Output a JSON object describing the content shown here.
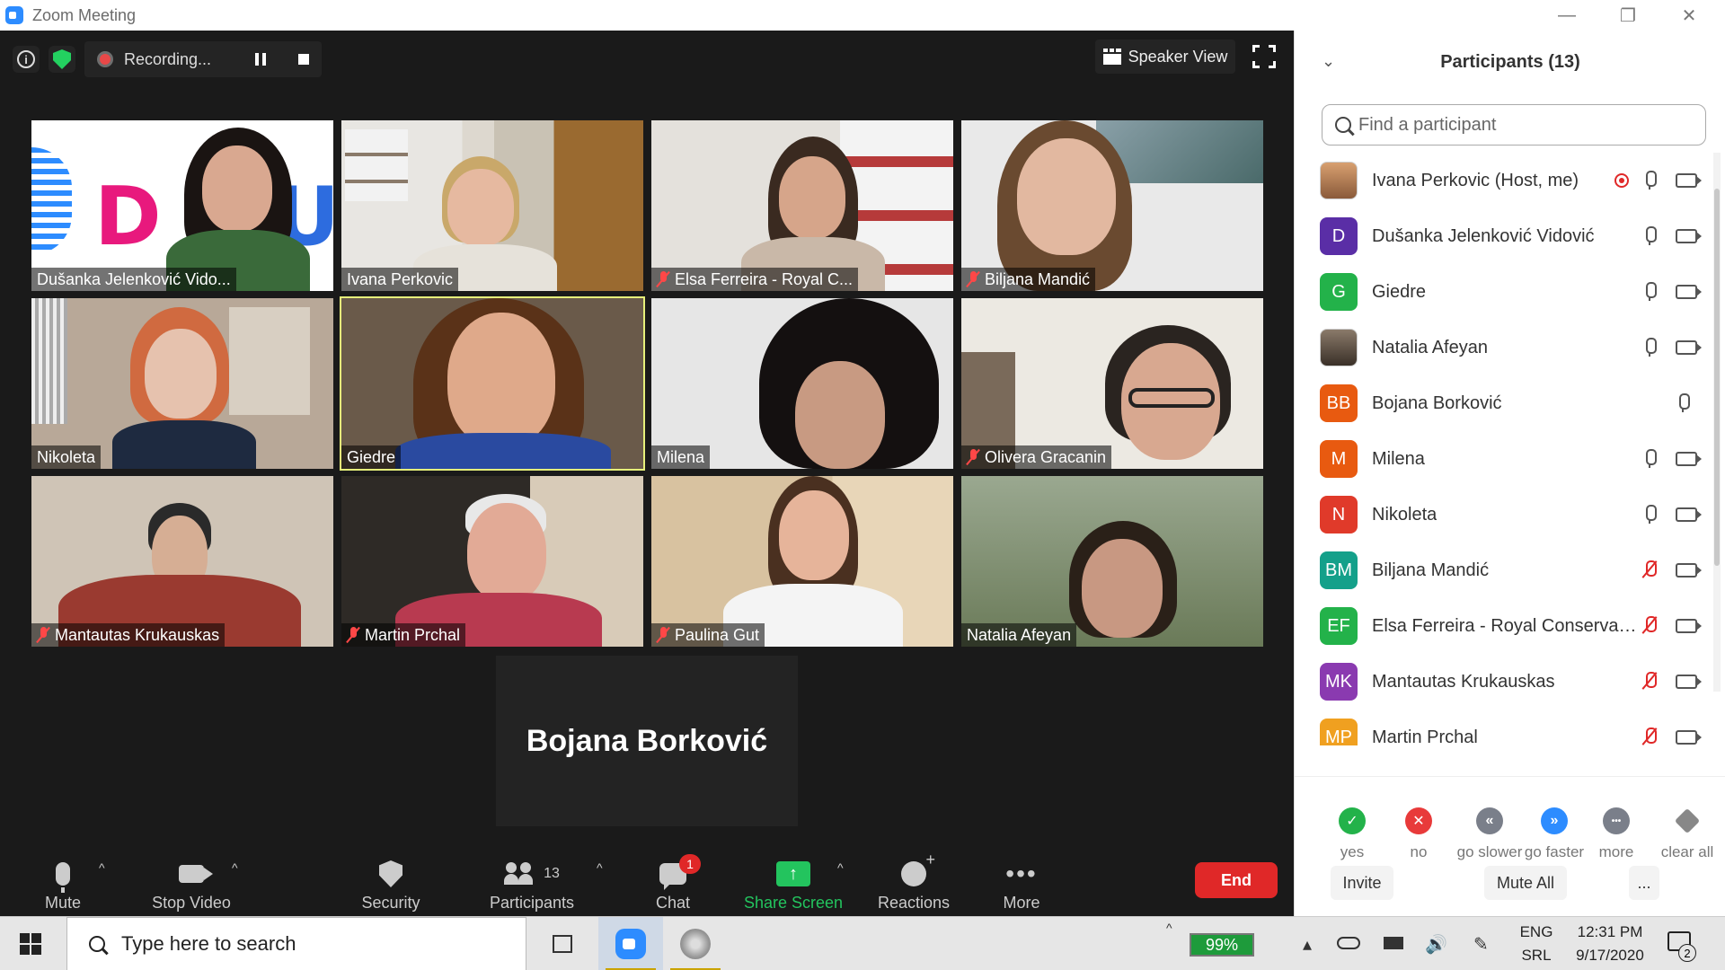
{
  "window": {
    "title": "Zoom Meeting",
    "controls": {
      "minimize": "—",
      "restore": "❐",
      "close": "✕"
    }
  },
  "meeting_topbar": {
    "info_icon": "info-icon",
    "security_icon": "shield-icon",
    "recording_label": "Recording...",
    "view_button_label": "Speaker View"
  },
  "tiles": [
    {
      "name": "Dušanka Jelenković Vido...",
      "muted": false,
      "active": false
    },
    {
      "name": "Ivana Perkovic",
      "muted": false,
      "active": false
    },
    {
      "name": "Elsa Ferreira - Royal C...",
      "muted": true,
      "active": false
    },
    {
      "name": "Biljana Mandić",
      "muted": true,
      "active": false
    },
    {
      "name": "Nikoleta",
      "muted": false,
      "active": false
    },
    {
      "name": "Giedre",
      "muted": false,
      "active": true
    },
    {
      "name": "Milena",
      "muted": false,
      "active": false
    },
    {
      "name": "Olivera Gracanin",
      "muted": true,
      "active": false
    },
    {
      "name": "Mantautas Krukauskas",
      "muted": true,
      "active": false
    },
    {
      "name": "Martin Prchal",
      "muted": true,
      "active": false
    },
    {
      "name": "Paulina Gut",
      "muted": true,
      "active": false
    },
    {
      "name": "Natalia Afeyan",
      "muted": false,
      "active": false
    }
  ],
  "name_only_tile": "Bojana Borković",
  "toolbar": {
    "mute": "Mute",
    "stop_video": "Stop Video",
    "security": "Security",
    "participants": "Participants",
    "participants_count": "13",
    "chat": "Chat",
    "chat_badge": "1",
    "share_screen": "Share Screen",
    "reactions": "Reactions",
    "more": "More",
    "end": "End",
    "more_dots": "•••",
    "caret": "^"
  },
  "panel": {
    "title": "Participants (13)",
    "collapse_icon": "⌄",
    "search_placeholder": "Find a participant",
    "participants": [
      {
        "name": "Ivana Perkovic (Host, me)",
        "initials": "",
        "avatar_color": "#b07a4a",
        "photo": true,
        "recording": true,
        "mic": "on",
        "camera": true
      },
      {
        "name": "Dušanka Jelenković Vidović",
        "initials": "D",
        "avatar_color": "#5a2ea6",
        "photo": false,
        "recording": false,
        "mic": "on",
        "camera": true
      },
      {
        "name": "Giedre",
        "initials": "G",
        "avatar_color": "#23b24a",
        "photo": false,
        "recording": false,
        "mic": "on",
        "camera": true
      },
      {
        "name": "Natalia Afeyan",
        "initials": "",
        "avatar_color": "#6a5a4a",
        "photo": true,
        "recording": false,
        "mic": "on",
        "camera": true
      },
      {
        "name": "Bojana Borković",
        "initials": "BB",
        "avatar_color": "#e85a10",
        "photo": false,
        "recording": false,
        "mic": "on",
        "camera": false
      },
      {
        "name": "Milena",
        "initials": "M",
        "avatar_color": "#e85a10",
        "photo": false,
        "recording": false,
        "mic": "on",
        "camera": true
      },
      {
        "name": "Nikoleta",
        "initials": "N",
        "avatar_color": "#e03a2a",
        "photo": false,
        "recording": false,
        "mic": "on",
        "camera": true
      },
      {
        "name": "Biljana Mandić",
        "initials": "BM",
        "avatar_color": "#14a08a",
        "photo": false,
        "recording": false,
        "mic": "muted",
        "camera": true
      },
      {
        "name": "Elsa Ferreira - Royal Conservatoi...",
        "initials": "EF",
        "avatar_color": "#23b24a",
        "photo": false,
        "recording": false,
        "mic": "muted",
        "camera": true
      },
      {
        "name": "Mantautas Krukauskas",
        "initials": "MK",
        "avatar_color": "#8a3ab0",
        "photo": false,
        "recording": false,
        "mic": "muted",
        "camera": true
      },
      {
        "name": "Martin Prchal",
        "initials": "MP",
        "avatar_color": "#f0a020",
        "photo": false,
        "recording": false,
        "mic": "muted",
        "camera": true
      }
    ],
    "feedback": [
      {
        "label": "yes",
        "symbol": "✓",
        "color": "#23b24a"
      },
      {
        "label": "no",
        "symbol": "✕",
        "color": "#e83a3a"
      },
      {
        "label": "go slower",
        "symbol": "«",
        "color": "#7a7f8a"
      },
      {
        "label": "go faster",
        "symbol": "»",
        "color": "#2d8cff"
      },
      {
        "label": "more",
        "symbol": "•••",
        "color": "#7a7f8a"
      },
      {
        "label": "clear all",
        "symbol": "",
        "color": "#888888"
      }
    ],
    "invite": "Invite",
    "mute_all": "Mute All",
    "more": "..."
  },
  "taskbar": {
    "search_text": "Type here to search",
    "battery": "99%",
    "lang_top": "ENG",
    "lang_bottom": "SRL",
    "time": "12:31 PM",
    "date": "9/17/2020",
    "notification_count": "2",
    "tray_icons": {
      "chevron": "^",
      "expand": "▴",
      "pen": "✎",
      "volume": "🔊"
    }
  },
  "colors": {
    "accent": "#2d8cff",
    "end": "#e02828",
    "share": "#23c45e",
    "active_speaker": "#e6f07a"
  }
}
